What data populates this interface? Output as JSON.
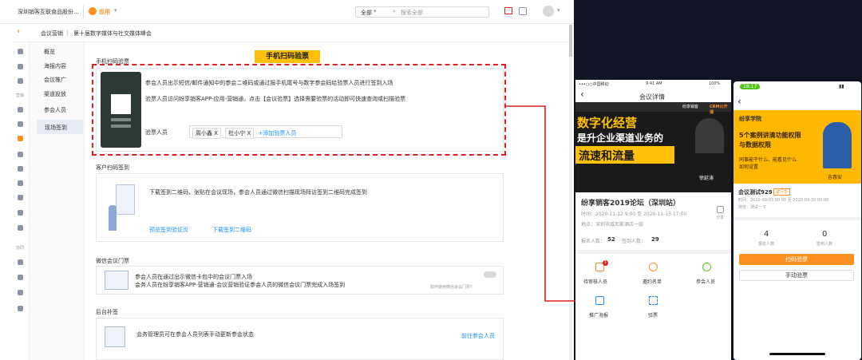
{
  "topbar": {
    "company": "深圳销客互联食品股份...",
    "app_label": "应用",
    "search_scope": "全部",
    "search_placeholder": "搜索全部"
  },
  "breadcrumb": {
    "root": "会议营销",
    "current": "第十届数字媒体与社交媒体峰会"
  },
  "subnav": {
    "items": [
      "概览",
      "海报内容",
      "会议推广",
      "渠道投放",
      "参会人员",
      "现场签到"
    ]
  },
  "rail": {
    "group1": "营销",
    "group2": "协同"
  },
  "sections": {
    "mobile": {
      "title": "手机扫码验票",
      "banner": "手机扫码验票",
      "desc1": "参会人员出示短信/邮件通知中的参会二维码或通过报手机尾号与数字参会码给验票人员进行签到入场",
      "desc2": "验票人员访问纷享销客APP-应用-营销通，点击【会议验票】选择需要验票的活动即可快速查询或扫描验票",
      "checker_label": "验票人员",
      "checkers": [
        "周小鑫 X",
        "杜小宁 X"
      ],
      "add_checker": "+添加验票人员"
    },
    "qr": {
      "title": "客户扫码签到",
      "desc": "下载签到二维码，张贴在会议现场，参会人员通过微信扫描现场拜访签到二维码完成签到",
      "preview_link": "预览签到验证页",
      "download_link": "下载签到二维码"
    },
    "wechat": {
      "title": "微信会议门票",
      "line1": "参会人员在通过出示微信卡包中的会议门票入场",
      "line2": "会务人员在纷享销客APP-营销通-会议营销验证参会人员的微信会议门票完成入场签到",
      "hint": "如何使用微信会议门票？"
    },
    "backend": {
      "title": "后台补签",
      "desc": "会务管理员可在参会人员列表手动更新参会状态",
      "link": "前往参会人员"
    }
  },
  "phone1": {
    "status": {
      "carrier": "•••○○中国移动",
      "time": "9:41 AM",
      "battery": "100%"
    },
    "title": "会议详情",
    "banner": {
      "line1": "数字化经营",
      "line2": "是升企业渠道业务的",
      "line3": "流速和流量",
      "brand": "纷享销客",
      "crm": "CRM公开课",
      "speaker": "徐延涛"
    },
    "event_title": "纷享销客2019论坛（深圳站）",
    "time_label": "时间：2020-11-12 9:00 至 2020-11-13 17:00",
    "place_label": "地点：深圳市威尼斯酒店一层",
    "share": "分享",
    "stats": {
      "signup_label": "报名人数：",
      "signup": "52",
      "signed_label": "签到人数：",
      "signed": "29"
    },
    "grid": [
      {
        "label": "待审核人员",
        "badge": "1"
      },
      {
        "label": "邀约名单",
        "badge": ""
      },
      {
        "label": "参会人员",
        "badge": ""
      },
      {
        "label": "推广海报",
        "badge": ""
      },
      {
        "label": "验票",
        "badge": ""
      }
    ]
  },
  "phone2": {
    "status": {
      "time": "18:17"
    },
    "banner": {
      "brand": "纷享学院",
      "line1": "5个案例讲清功能权限",
      "line2": "与数据权限",
      "line3": "同事能干什么、能看见什么",
      "line4": "如何设置",
      "speaker": "吉惠安"
    },
    "title": "会议测试929",
    "status_tag": "进行中",
    "time": "时间：2020-09-03 00:00 至 2020-09-30 00:00",
    "place": "地址：测试一下",
    "stats": [
      {
        "value": "4",
        "label": "报名人数"
      },
      {
        "value": "0",
        "label": "签到人数"
      }
    ],
    "scan_btn": "扫码验票",
    "manual_btn": "手动验票"
  },
  "colors": {
    "accent": "#ff8f1f",
    "link": "#1890ff",
    "dash": "#e02020",
    "arrow": "#e02020"
  }
}
